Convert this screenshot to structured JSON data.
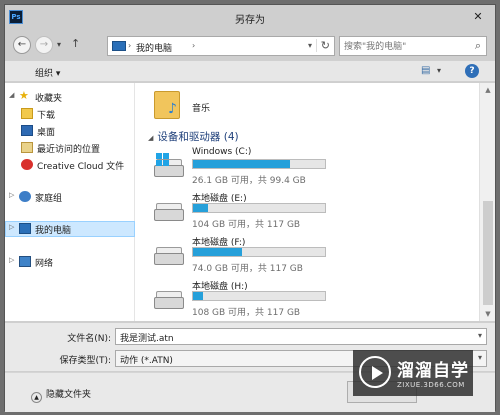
{
  "window": {
    "title": "另存为",
    "app_icon": "Ps"
  },
  "address": {
    "crumb": "我的电脑",
    "search_placeholder": "搜索\"我的电脑\""
  },
  "toolbar": {
    "organize": "组织 ▾"
  },
  "nav": {
    "favorites": "收藏夹",
    "items": [
      "下载",
      "桌面",
      "最近访问的位置",
      "Creative Cloud 文件"
    ],
    "homegroup": "家庭组",
    "this_pc": "我的电脑",
    "network": "网络"
  },
  "main": {
    "music": "音乐",
    "section_title": "设备和驱动器 (4)",
    "drives": [
      {
        "name": "Windows (C:)",
        "free_text": "26.1 GB 可用，共 99.4 GB",
        "used_fraction": 0.737
      },
      {
        "name": "本地磁盘 (E:)",
        "free_text": "104 GB 可用，共 117 GB",
        "used_fraction": 0.111
      },
      {
        "name": "本地磁盘 (F:)",
        "free_text": "74.0 GB 可用，共 117 GB",
        "used_fraction": 0.368
      },
      {
        "name": "本地磁盘 (H:)",
        "free_text": "108 GB 可用，共 117 GB",
        "used_fraction": 0.077
      }
    ]
  },
  "form": {
    "filename_label": "文件名(N):",
    "filename_value": "我是测试.atn",
    "filetype_label": "保存类型(T):",
    "filetype_value": "动作 (*.ATN)"
  },
  "footer": {
    "hide_folders": "隐藏文件夹"
  },
  "watermark": {
    "name": "溜溜自学",
    "url": "ZIXUE.3D66.COM"
  }
}
